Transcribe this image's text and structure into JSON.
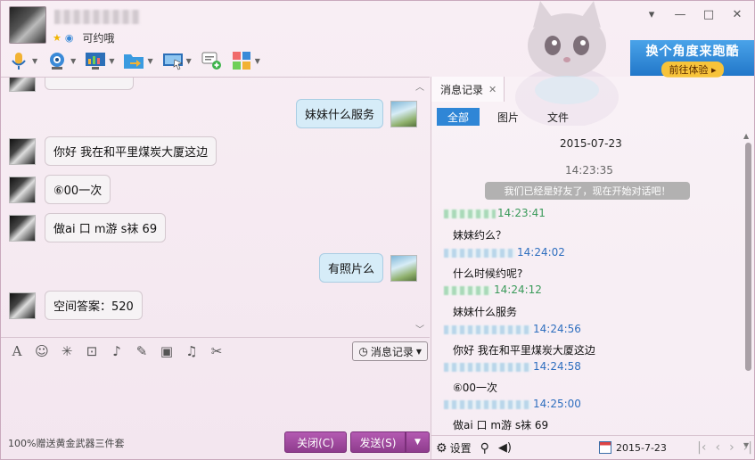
{
  "header": {
    "signature": "可约哦",
    "window_buttons": [
      "▾",
      "—",
      "□",
      "✕"
    ]
  },
  "toolbar": {
    "icons": [
      "microphone-icon",
      "video-call-icon",
      "screen-share-icon",
      "file-transfer-icon",
      "remote-desktop-icon",
      "multi-chat-icon",
      "app-grid-icon"
    ]
  },
  "banner": {
    "title": "换个角度来跑酷",
    "cta": "前往体验 ▸"
  },
  "chat": {
    "messages": [
      {
        "from": "me",
        "text": "妹妹什么服务"
      },
      {
        "from": "her",
        "text": "你好 我在和平里煤炭大厦这边"
      },
      {
        "from": "her",
        "text": "⑥00一次"
      },
      {
        "from": "her",
        "text": "做ai 口  m游 s袜  69"
      },
      {
        "from": "me",
        "text": "有照片么"
      },
      {
        "from": "her",
        "text": "空间答案：520"
      }
    ]
  },
  "input_toolbar": {
    "history_button": "消息记录"
  },
  "footer": {
    "promo": "100%赠送黄金武器三件套",
    "close": "关闭(C)",
    "send": "发送(S)"
  },
  "history": {
    "tab_label": "消息记录",
    "filters": [
      "全部",
      "图片",
      "文件"
    ],
    "date_header": "2015-07-23",
    "first_time": "14:23:35",
    "system_msg": "我们已经是好友了，现在开始对话吧！",
    "entries": [
      {
        "time": "14:23:41",
        "side": "her",
        "text": "妹妹约么？"
      },
      {
        "time": "14:24:02",
        "side": "me",
        "text": "什么时候约呢?"
      },
      {
        "time": "14:24:12",
        "side": "her",
        "text": "妹妹什么服务"
      },
      {
        "time": "14:24:56",
        "side": "me",
        "text": "你好 我在和平里煤炭大厦这边"
      },
      {
        "time": "14:24:58",
        "side": "me",
        "text": "⑥00一次"
      },
      {
        "time": "14:25:00",
        "side": "me",
        "text": "做ai 口  m游 s袜  69"
      }
    ],
    "footer": {
      "settings": "设置",
      "date": "2015-7-23"
    }
  },
  "colors": {
    "accent_blue": "#2f86d6",
    "send_purple": "#9b4a9a",
    "time_green": "#3a9a5a",
    "time_blue": "#2f6fbf"
  }
}
